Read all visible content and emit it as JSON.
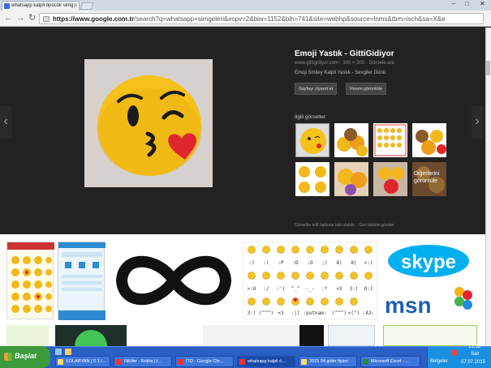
{
  "browser": {
    "tab_title": "whatsapp kalpli öpücük simg...",
    "url_domain": "https://www.google.com.tr",
    "url_rest": "/search?q=whatsapp+simgeleri&espv=2&biw=1152&bih=741&site=webhp&source=lnms&tbm=isch&sa=X&e"
  },
  "detail": {
    "title": "Emoji Yastık - GittiGidiyor",
    "meta": "www.gittigidiyor.com · 300 × 300 · Görsele ara",
    "description": "Emoji Smiley Kalpli Yastık - Sevgiler Günü",
    "visit_label": "Sayfayı ziyaret et",
    "view_label": "Resmi görüntüle",
    "related_label": "İlgili görseller:",
    "more_label": "Diğerlerini görüntüle",
    "footer": "Görseller telif hakkına tabi olabilir.  ·  Geri bildirim gönder"
  },
  "grid": {
    "emoticons": [
      ":)",
      ":(",
      ":P",
      ":D",
      ":O",
      ";)",
      "8)",
      "8|",
      ">:(",
      ">:O",
      ":/",
      ":'(",
      "^_^",
      "-_-",
      ":*",
      "<3",
      "3:)",
      "O:)",
      "3:)",
      "(^^^)",
      "<3",
      ":|]",
      ":putnam:",
      "(^^^)",
      "<(\")",
      ":42:"
    ],
    "skype_label": "skype",
    "msn_label": "msn"
  },
  "taskbar": {
    "start_label": "Başlat",
    "buttons": [
      "SOLARYAN [ 0 1 /...",
      "Nilüfer - Nokta | I...",
      "İTO - Google Chr...",
      "whatsapp kalpli ö...",
      "2015 04 gider fişleri",
      "Microsoft Excel - ..."
    ],
    "documents_label": "Belgeler",
    "time": "15:33",
    "day": "Salı",
    "date": "07.07.2015"
  },
  "colors": {
    "emoji_yellow": "#f6c11a",
    "heart_red": "#e0262d",
    "taskbar_blue": "#2a5fc4",
    "start_green": "#3b9a3b"
  }
}
